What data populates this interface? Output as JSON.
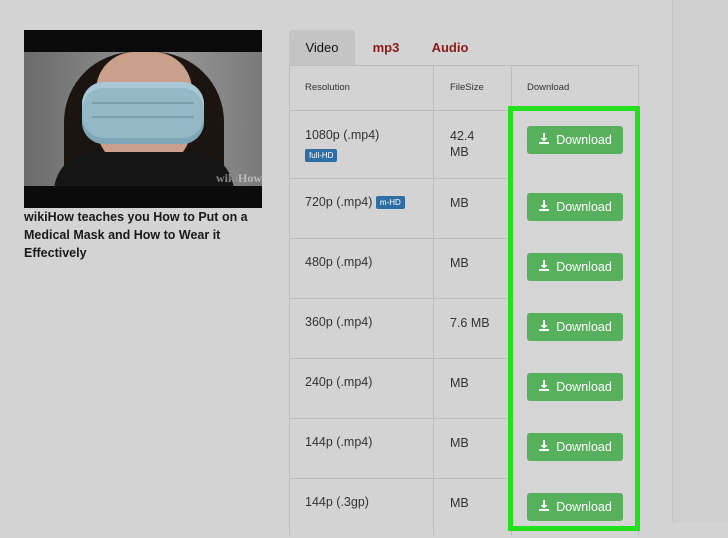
{
  "video": {
    "title": "wikiHow teaches you How to Put on a Medical Mask and How to Wear it Effectively",
    "watermark_wiki": "wiki",
    "watermark_how": "How"
  },
  "tabs": [
    "Video",
    "mp3",
    "Audio"
  ],
  "table": {
    "headers": {
      "resolution": "Resolution",
      "filesize": "FileSize",
      "download": "Download"
    },
    "rows": [
      {
        "resolution": "1080p (.mp4)",
        "badge": "full-HD",
        "size": "42.4 MB",
        "button": "Download"
      },
      {
        "resolution": "720p (.mp4)",
        "badge": "m-HD",
        "size": "MB",
        "button": "Download"
      },
      {
        "resolution": "480p (.mp4)",
        "badge": "",
        "size": "MB",
        "button": "Download"
      },
      {
        "resolution": "360p (.mp4)",
        "badge": "",
        "size": "7.6 MB",
        "button": "Download"
      },
      {
        "resolution": "240p (.mp4)",
        "badge": "",
        "size": "MB",
        "button": "Download"
      },
      {
        "resolution": "144p (.mp4)",
        "badge": "",
        "size": "MB",
        "button": "Download"
      },
      {
        "resolution": "144p (.3gp)",
        "badge": "",
        "size": "MB",
        "button": "Download"
      }
    ]
  },
  "colors": {
    "download_button": "#57b05c",
    "highlight_border": "#22e01c",
    "tab_link": "#8b1a1a",
    "badge": "#2e6ea5"
  },
  "icons": {
    "download": "download-icon"
  }
}
